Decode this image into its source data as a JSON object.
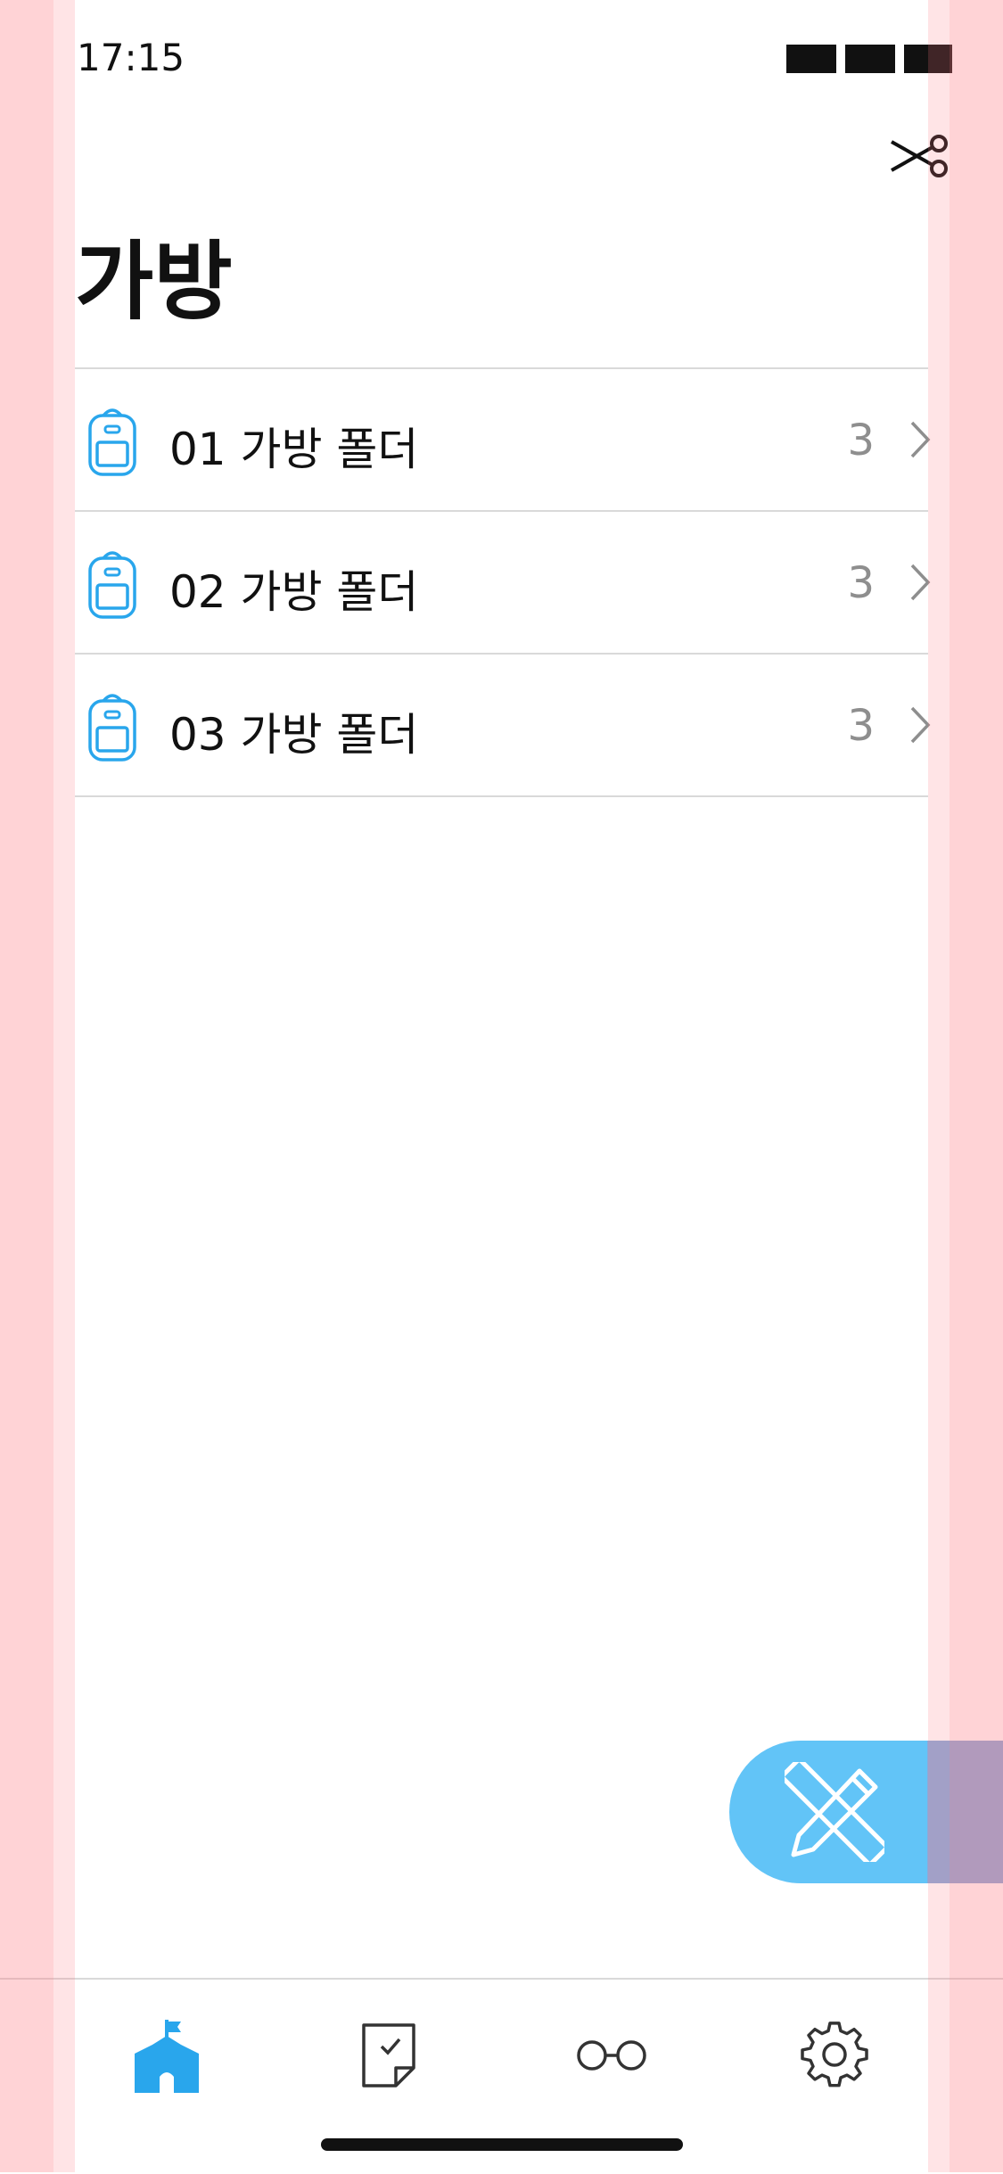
{
  "status_bar": {
    "time": "17:15"
  },
  "header": {
    "title": "가방"
  },
  "folders": [
    {
      "label": "01 가방 폴더",
      "count": "3"
    },
    {
      "label": "02 가방 폴더",
      "count": "3"
    },
    {
      "label": "03 가방 폴더",
      "count": "3"
    }
  ],
  "icons": {
    "top_right": "scissors-icon",
    "folder": "backpack-icon",
    "row_chevron": "chevron-right-icon",
    "fab": "pencil-ruler-icon",
    "tabs": [
      "school-icon",
      "checked-note-icon",
      "glasses-icon",
      "gear-icon"
    ]
  },
  "colors": {
    "accent": "#29a6ec",
    "fab": "#62c4f7",
    "divider": "#d9d9d9",
    "count": "#8e8e8e"
  }
}
